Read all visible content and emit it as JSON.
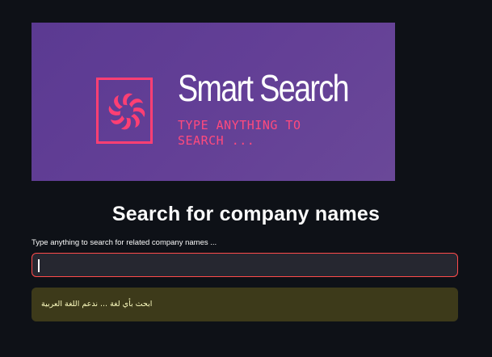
{
  "banner": {
    "title": "Smart Search",
    "tagline": "TYPE ANYTHING TO SEARCH ...",
    "logo_icon": "spiral-flower-icon"
  },
  "page": {
    "heading": "Search for company names"
  },
  "search": {
    "label": "Type anything to search for related company names ...",
    "value": "",
    "placeholder": ""
  },
  "notice": {
    "text": "ابحث بأي لغة ... ندعم اللغة العربية"
  },
  "colors": {
    "background": "#0e1117",
    "banner_purple": "#633f96",
    "brand_pink": "#ff3f73",
    "input_border": "#ff4b4b",
    "input_bg": "#262730",
    "notice_bg": "#3d3a1a",
    "notice_text": "#ffffc2"
  }
}
